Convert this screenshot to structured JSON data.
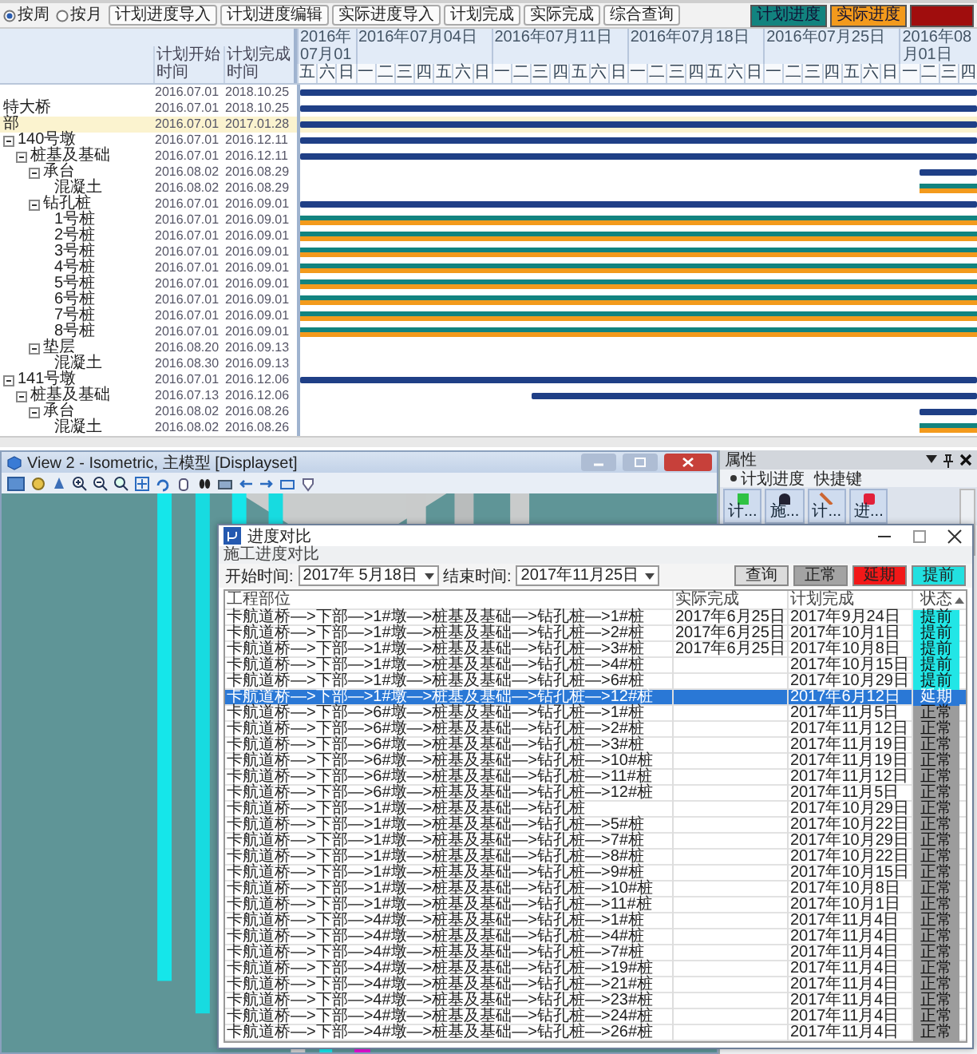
{
  "gantt": {
    "view_options": [
      {
        "label": "按周",
        "selected": true
      },
      {
        "label": "按月",
        "selected": false
      }
    ],
    "buttons": [
      "计划进度导入",
      "计划进度编辑",
      "实际进度导入",
      "计划完成",
      "实际完成",
      "综合查询"
    ],
    "legend": [
      {
        "label": "计划进度",
        "color": "#12837f"
      },
      {
        "label": "实际进度",
        "color": "#f39a1c"
      },
      {
        "color": "#a00d0d"
      }
    ],
    "columns": [
      "计划开始时间",
      "计划完成时间"
    ],
    "weeks": [
      "2016年07月01",
      "2016年07月04日",
      "2016年07月11日",
      "2016年07月18日",
      "2016年07月25日",
      "2016年08月01日"
    ],
    "days": [
      "五",
      "六",
      "日",
      "一",
      "二",
      "三",
      "四",
      "五",
      "六",
      "日",
      "一",
      "二",
      "三",
      "四",
      "五",
      "六",
      "日",
      "一",
      "二",
      "三",
      "四",
      "五",
      "六",
      "日",
      "一",
      "二",
      "三",
      "四",
      "五",
      "六",
      "日",
      "一",
      "二",
      "三",
      "四"
    ],
    "rows": [
      {
        "start": "2016.07.01",
        "end": "2018.10.25",
        "kind": "summary",
        "selected": false,
        "children": [
          {
            "name": "特大桥",
            "start": "2016.07.01",
            "end": "2018.10.25",
            "kind": "summary",
            "selected": false,
            "children": [
              {
                "name": "部",
                "start": "2016.07.01",
                "end": "2017.01.28",
                "kind": "summary",
                "selected": true,
                "children": [
                  {
                    "name": "140号墩",
                    "start": "2016.07.01",
                    "end": "2016.12.11",
                    "kind": "summary",
                    "selected": false,
                    "expanded": true,
                    "children": [
                      {
                        "name": "桩基及基础",
                        "start": "2016.07.01",
                        "end": "2016.12.11",
                        "kind": "summary",
                        "selected": false,
                        "expanded": true,
                        "children": [
                          {
                            "name": "承台",
                            "start": "2016.08.02",
                            "end": "2016.08.29",
                            "kind": "summary",
                            "selected": false,
                            "expanded": true,
                            "children": [
                              {
                                "name": "混凝土",
                                "start": "2016.08.02",
                                "end": "2016.08.29",
                                "kind": "task",
                                "selected": false
                              }
                            ]
                          },
                          {
                            "name": "钻孔桩",
                            "start": "2016.07.01",
                            "end": "2016.09.01",
                            "kind": "summary",
                            "selected": false,
                            "expanded": true,
                            "children": [
                              {
                                "name": "1号桩",
                                "start": "2016.07.01",
                                "end": "2016.09.01",
                                "kind": "task",
                                "selected": false
                              },
                              {
                                "name": "2号桩",
                                "start": "2016.07.01",
                                "end": "2016.09.01",
                                "kind": "task",
                                "selected": false
                              },
                              {
                                "name": "3号桩",
                                "start": "2016.07.01",
                                "end": "2016.09.01",
                                "kind": "task",
                                "selected": false
                              },
                              {
                                "name": "4号桩",
                                "start": "2016.07.01",
                                "end": "2016.09.01",
                                "kind": "task",
                                "selected": false
                              },
                              {
                                "name": "5号桩",
                                "start": "2016.07.01",
                                "end": "2016.09.01",
                                "kind": "task",
                                "selected": false
                              },
                              {
                                "name": "6号桩",
                                "start": "2016.07.01",
                                "end": "2016.09.01",
                                "kind": "task",
                                "selected": false
                              },
                              {
                                "name": "7号桩",
                                "start": "2016.07.01",
                                "end": "2016.09.01",
                                "kind": "task",
                                "selected": false
                              },
                              {
                                "name": "8号桩",
                                "start": "2016.07.01",
                                "end": "2016.09.01",
                                "kind": "task",
                                "selected": false
                              }
                            ]
                          },
                          {
                            "name": "垫层",
                            "start": "2016.08.20",
                            "end": "2016.09.13",
                            "kind": "summary",
                            "selected": false,
                            "expanded": true,
                            "children": [
                              {
                                "name": "混凝土",
                                "start": "2016.08.30",
                                "end": "2016.09.13",
                                "kind": "task",
                                "selected": false
                              }
                            ]
                          }
                        ]
                      }
                    ]
                  },
                  {
                    "name": "141号墩",
                    "start": "2016.07.01",
                    "end": "2016.12.06",
                    "kind": "summary",
                    "selected": false,
                    "expanded": true,
                    "children": [
                      {
                        "name": "桩基及基础",
                        "start": "2016.07.13",
                        "end": "2016.12.06",
                        "kind": "summary",
                        "selected": false,
                        "expanded": true,
                        "children": [
                          {
                            "name": "承台",
                            "start": "2016.08.02",
                            "end": "2016.08.26",
                            "kind": "summary",
                            "selected": false,
                            "expanded": true,
                            "children": [
                              {
                                "name": "混凝土",
                                "start": "2016.08.02",
                                "end": "2016.08.26",
                                "kind": "task",
                                "selected": false
                              }
                            ]
                          }
                        ]
                      }
                    ]
                  }
                ]
              }
            ]
          }
        ]
      }
    ]
  },
  "view_window": {
    "title": "View 2 - Isometric, 主模型 [Displayset]"
  },
  "properties": {
    "title": "属性",
    "tabs": [
      {
        "label": "计划进度",
        "selected": true
      },
      {
        "label": "快捷键",
        "selected": false
      }
    ],
    "tools": [
      "计...",
      "施...",
      "计...",
      "进..."
    ]
  },
  "dialog": {
    "title": "进度对比",
    "subtitle": "施工进度对比",
    "start_label": "开始时间:",
    "start_value": "2017年 5月18日",
    "end_label": "结束时间:",
    "end_value": "2017年11月25日",
    "filters": [
      {
        "label": "查询",
        "color": "#dcdcdc"
      },
      {
        "label": "正常",
        "color": "#a3a3a3"
      },
      {
        "label": "延期",
        "color": "#f21818"
      },
      {
        "label": "提前",
        "color": "#22e0e0"
      }
    ],
    "columns": [
      "工程部位",
      "实际完成",
      "计划完成",
      "状态"
    ],
    "rows": [
      {
        "location": "卡航道桥—>下部—>1#墩—>桩基及基础—>钻孔桩—>1#桩",
        "actual": "2017年6月25日",
        "planned": "2017年9月24日",
        "status": "提前",
        "kind": "ahead",
        "selected": false
      },
      {
        "location": "卡航道桥—>下部—>1#墩—>桩基及基础—>钻孔桩—>2#桩",
        "actual": "2017年6月25日",
        "planned": "2017年10月1日",
        "status": "提前",
        "kind": "ahead",
        "selected": false
      },
      {
        "location": "卡航道桥—>下部—>1#墩—>桩基及基础—>钻孔桩—>3#桩",
        "actual": "2017年6月25日",
        "planned": "2017年10月8日",
        "status": "提前",
        "kind": "ahead",
        "selected": false
      },
      {
        "location": "卡航道桥—>下部—>1#墩—>桩基及基础—>钻孔桩—>4#桩",
        "planned": "2017年10月15日",
        "status": "提前",
        "kind": "ahead",
        "selected": false
      },
      {
        "location": "卡航道桥—>下部—>1#墩—>桩基及基础—>钻孔桩—>6#桩",
        "planned": "2017年10月29日",
        "status": "提前",
        "kind": "ahead",
        "selected": false
      },
      {
        "location": "卡航道桥—>下部—>1#墩—>桩基及基础—>钻孔桩—>12#桩",
        "planned": "2017年6月12日",
        "status": "延期",
        "kind": "delayed",
        "selected": true
      },
      {
        "location": "卡航道桥—>下部—>6#墩—>桩基及基础—>钻孔桩—>1#桩",
        "planned": "2017年11月5日",
        "status": "正常",
        "kind": "normal",
        "selected": false
      },
      {
        "location": "卡航道桥—>下部—>6#墩—>桩基及基础—>钻孔桩—>2#桩",
        "planned": "2017年11月12日",
        "status": "正常",
        "kind": "normal",
        "selected": false
      },
      {
        "location": "卡航道桥—>下部—>6#墩—>桩基及基础—>钻孔桩—>3#桩",
        "planned": "2017年11月19日",
        "status": "正常",
        "kind": "normal",
        "selected": false
      },
      {
        "location": "卡航道桥—>下部—>6#墩—>桩基及基础—>钻孔桩—>10#桩",
        "planned": "2017年11月19日",
        "status": "正常",
        "kind": "normal",
        "selected": false
      },
      {
        "location": "卡航道桥—>下部—>6#墩—>桩基及基础—>钻孔桩—>11#桩",
        "planned": "2017年11月12日",
        "status": "正常",
        "kind": "normal",
        "selected": false
      },
      {
        "location": "卡航道桥—>下部—>6#墩—>桩基及基础—>钻孔桩—>12#桩",
        "planned": "2017年11月5日",
        "status": "正常",
        "kind": "normal",
        "selected": false
      },
      {
        "location": "卡航道桥—>下部—>1#墩—>桩基及基础—>钻孔桩",
        "planned": "2017年10月29日",
        "status": "正常",
        "kind": "normal",
        "selected": false
      },
      {
        "location": "卡航道桥—>下部—>1#墩—>桩基及基础—>钻孔桩—>5#桩",
        "planned": "2017年10月22日",
        "status": "正常",
        "kind": "normal",
        "selected": false
      },
      {
        "location": "卡航道桥—>下部—>1#墩—>桩基及基础—>钻孔桩—>7#桩",
        "planned": "2017年10月29日",
        "status": "正常",
        "kind": "normal",
        "selected": false
      },
      {
        "location": "卡航道桥—>下部—>1#墩—>桩基及基础—>钻孔桩—>8#桩",
        "planned": "2017年10月22日",
        "status": "正常",
        "kind": "normal",
        "selected": false
      },
      {
        "location": "卡航道桥—>下部—>1#墩—>桩基及基础—>钻孔桩—>9#桩",
        "planned": "2017年10月15日",
        "status": "正常",
        "kind": "normal",
        "selected": false
      },
      {
        "location": "卡航道桥—>下部—>1#墩—>桩基及基础—>钻孔桩—>10#桩",
        "planned": "2017年10月8日",
        "status": "正常",
        "kind": "normal",
        "selected": false
      },
      {
        "location": "卡航道桥—>下部—>1#墩—>桩基及基础—>钻孔桩—>11#桩",
        "planned": "2017年10月1日",
        "status": "正常",
        "kind": "normal",
        "selected": false
      },
      {
        "location": "卡航道桥—>下部—>4#墩—>桩基及基础—>钻孔桩—>1#桩",
        "planned": "2017年11月4日",
        "status": "正常",
        "kind": "normal",
        "selected": false
      },
      {
        "location": "卡航道桥—>下部—>4#墩—>桩基及基础—>钻孔桩—>4#桩",
        "planned": "2017年11月4日",
        "status": "正常",
        "kind": "normal",
        "selected": false
      },
      {
        "location": "卡航道桥—>下部—>4#墩—>桩基及基础—>钻孔桩—>7#桩",
        "planned": "2017年11月4日",
        "status": "正常",
        "kind": "normal",
        "selected": false
      },
      {
        "location": "卡航道桥—>下部—>4#墩—>桩基及基础—>钻孔桩—>19#桩",
        "planned": "2017年11月4日",
        "status": "正常",
        "kind": "normal",
        "selected": false
      },
      {
        "location": "卡航道桥—>下部—>4#墩—>桩基及基础—>钻孔桩—>21#桩",
        "planned": "2017年11月4日",
        "status": "正常",
        "kind": "normal",
        "selected": false
      },
      {
        "location": "卡航道桥—>下部—>4#墩—>桩基及基础—>钻孔桩—>23#桩",
        "planned": "2017年11月4日",
        "status": "正常",
        "kind": "normal",
        "selected": false
      },
      {
        "location": "卡航道桥—>下部—>4#墩—>桩基及基础—>钻孔桩—>24#桩",
        "planned": "2017年11月4日",
        "status": "正常",
        "kind": "normal",
        "selected": false
      },
      {
        "location": "卡航道桥—>下部—>4#墩—>桩基及基础—>钻孔桩—>26#桩",
        "planned": "2017年11月4日",
        "status": "正常",
        "kind": "normal",
        "selected": false
      }
    ]
  }
}
